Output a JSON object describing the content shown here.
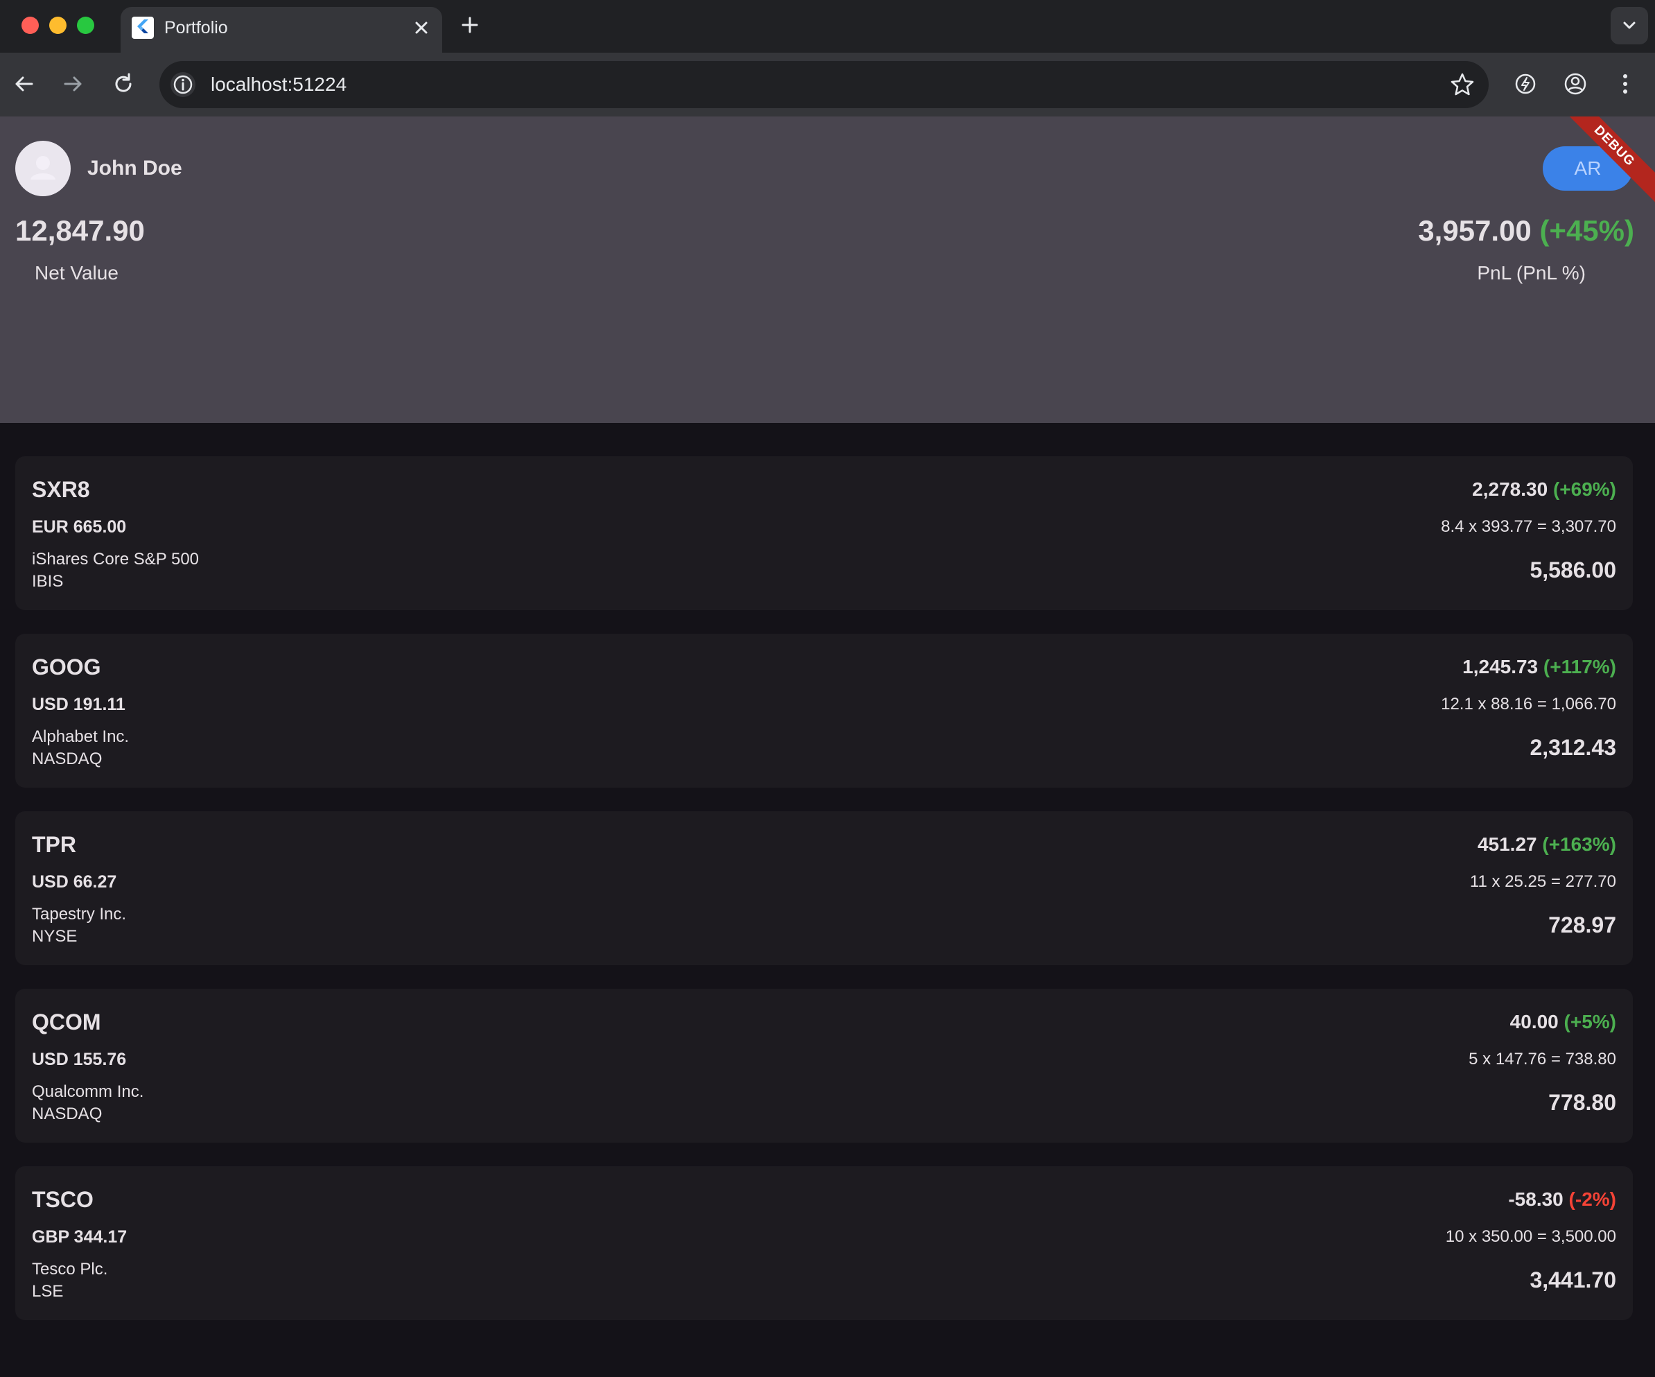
{
  "browser": {
    "tab_title": "Portfolio",
    "url": "localhost:51224",
    "icons": {
      "tab_close": "close-icon",
      "new_tab": "plus-icon",
      "back": "arrow-left-icon",
      "forward": "arrow-right-icon",
      "reload": "reload-icon",
      "site_info": "info-icon",
      "bookmark": "star-icon",
      "extension": "performance-icon",
      "profile": "account-icon",
      "menu": "kebab-menu-icon",
      "tab_search": "chevron-down-icon"
    }
  },
  "header": {
    "user_name": "John Doe",
    "ar_button_label": "AR",
    "debug_banner": "DEBUG",
    "net_value": "12,847.90",
    "net_value_label": "Net Value",
    "pnl_value": "3,957.00",
    "pnl_percent": "(+45%)",
    "pnl_label": "PnL (PnL %)"
  },
  "holdings": [
    {
      "symbol": "SXR8",
      "price": "EUR 665.00",
      "name": "iShares Core S&P 500",
      "exchange": "IBIS",
      "pnl": "2,278.30",
      "pnl_percent": "(+69%)",
      "calculation": "8.4 x 393.77 = 3,307.70",
      "value": "5,586.00"
    },
    {
      "symbol": "GOOG",
      "price": "USD 191.11",
      "name": "Alphabet Inc.",
      "exchange": "NASDAQ",
      "pnl": "1,245.73",
      "pnl_percent": "(+117%)",
      "calculation": "12.1 x 88.16 = 1,066.70",
      "value": "2,312.43"
    },
    {
      "symbol": "TPR",
      "price": "USD 66.27",
      "name": "Tapestry Inc.",
      "exchange": "NYSE",
      "pnl": "451.27",
      "pnl_percent": "(+163%)",
      "calculation": "11 x 25.25 = 277.70",
      "value": "728.97"
    },
    {
      "symbol": "QCOM",
      "price": "USD 155.76",
      "name": "Qualcomm Inc.",
      "exchange": "NASDAQ",
      "pnl": "40.00",
      "pnl_percent": "(+5%)",
      "calculation": "5 x 147.76 = 738.80",
      "value": "778.80"
    },
    {
      "symbol": "TSCO",
      "price": "GBP 344.17",
      "name": "Tesco Plc.",
      "exchange": "LSE",
      "pnl": "-58.30",
      "pnl_percent": "(-2%)",
      "calculation": "10 x 350.00 = 3,500.00",
      "value": "3,441.70"
    }
  ],
  "colors": {
    "positive": "#4caf50",
    "negative": "#f44336",
    "header_bg": "#49454f",
    "card_bg": "#1d1b20",
    "page_bg": "#141218",
    "ar_button": "#3b82e8"
  }
}
